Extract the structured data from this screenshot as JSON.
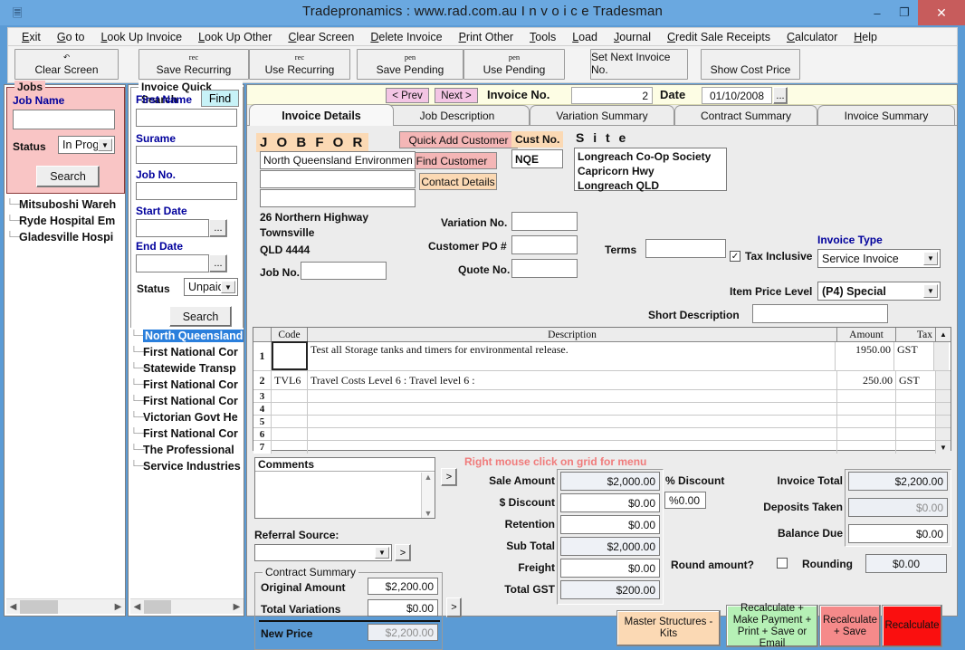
{
  "window": {
    "title": "Tradepronamics :   www.rad.com.au     I n v o i c e   Tradesman",
    "minimize": "–",
    "maximize": "❐",
    "close": "✕"
  },
  "menu": [
    "Exit",
    "Go to",
    "Look Up Invoice",
    "Look Up Other",
    "Clear Screen",
    "Delete Invoice",
    "Print Other",
    "Tools",
    "Load",
    "Journal",
    "Credit Sale Receipts",
    "Calculator",
    "Help"
  ],
  "toolbar": [
    {
      "glyph": "↶",
      "label": "Clear Screen"
    },
    {
      "glyph": "rec",
      "label": "Save Recurring"
    },
    {
      "glyph": "rec",
      "label": "Use Recurring"
    },
    {
      "glyph": "pen",
      "label": "Save Pending"
    },
    {
      "glyph": "pen",
      "label": "Use Pending"
    },
    {
      "glyph": "",
      "label": "Set Next  Invoice No."
    },
    {
      "glyph": "",
      "label": "Show Cost Price"
    }
  ],
  "jobs_panel": {
    "legend": "Jobs",
    "job_name_label": "Job Name",
    "job_name_value": "",
    "status_label": "Status",
    "status_value": "In Progr",
    "search_label": "Search",
    "tree": [
      "Mitsuboshi Wareh",
      "Ryde Hospital Em",
      "Gladesville Hospi"
    ]
  },
  "quick_search": {
    "legend": "Invoice Quick Search",
    "find_label": "Find",
    "first_name_label": "First Name",
    "first_name_value": "",
    "surname_label": "Surame",
    "surname_value": "",
    "job_no_label": "Job No.",
    "job_no_value": "",
    "start_date_label": "Start Date",
    "start_date_value": "",
    "end_date_label": "End Date",
    "end_date_value": "",
    "status_label": "Status",
    "status_value": "Unpaid",
    "search_label": "Search",
    "dots": "...",
    "results": [
      "North Queensland",
      "First National Cor",
      "Statewide Transp",
      "First National Cor",
      "First National Cor",
      "Victorian Govt He",
      "First National Cor",
      "The Professional",
      "Service Industries"
    ]
  },
  "invoice_bar": {
    "prev": "< Prev",
    "next": "Next >",
    "invoice_no_label": "Invoice No.",
    "invoice_no_value": "2",
    "date_label": "Date",
    "date_value": "01/10/2008",
    "date_picker": "..."
  },
  "tabs": [
    {
      "label": "Invoice Details",
      "active": true
    },
    {
      "label": "Job Description",
      "active": false
    },
    {
      "label": "Variation Summary",
      "active": false
    },
    {
      "label": "Contract Summary",
      "active": false
    },
    {
      "label": "Invoice Summary",
      "active": false
    }
  ],
  "details": {
    "job_for_label": "J O B  F O R",
    "quick_add_customer": "Quick Add Customer",
    "find_customer": "Find Customer",
    "contact_details": "Contact Details",
    "customer_name": "North Queensland Environmen",
    "customer_line2": "",
    "customer_line3": "",
    "address_line1": "26 Northern Highway",
    "address_line2": "Townsville",
    "address_line3": "QLD  4444",
    "job_no_label": "Job No.",
    "job_no_value": "",
    "cust_no_label": "Cust No.",
    "cust_no_value": "NQE",
    "site_label": "S i t e",
    "site_lines": [
      "Longreach Co-Op Society",
      "Capricorn Hwy",
      "Longreach QLD"
    ],
    "variation_no_label": "Variation No.",
    "variation_no_value": "",
    "customer_po_label": "Customer PO #",
    "customer_po_value": "",
    "quote_no_label": "Quote No.",
    "quote_no_value": "",
    "tax_inclusive_label": "Tax Inclusive",
    "tax_inclusive_checked": true,
    "invoice_type_label": "Invoice Type",
    "invoice_type_value": "Service Invoice",
    "terms_label": "Terms",
    "terms_value": "",
    "item_price_level_label": "Item Price Level",
    "item_price_level_value": "(P4) Special",
    "short_description_label": "Short Description",
    "short_description_value": ""
  },
  "grid": {
    "columns": [
      "",
      "Code",
      "Description",
      "Amount",
      "Tax"
    ],
    "rows": [
      {
        "n": "1",
        "code": "",
        "description": "Test all Storage tanks and timers for environmental release.",
        "amount": "1950.00",
        "tax": "GST"
      },
      {
        "n": "2",
        "code": "TVL6",
        "description": "Travel Costs Level 6 : Travel level 6 :",
        "amount": "250.00",
        "tax": "GST"
      },
      {
        "n": "3",
        "code": "",
        "description": "",
        "amount": "",
        "tax": ""
      },
      {
        "n": "4",
        "code": "",
        "description": "",
        "amount": "",
        "tax": ""
      },
      {
        "n": "5",
        "code": "",
        "description": "",
        "amount": "",
        "tax": ""
      },
      {
        "n": "6",
        "code": "",
        "description": "",
        "amount": "",
        "tax": ""
      },
      {
        "n": "7",
        "code": "",
        "description": "",
        "amount": "",
        "tax": ""
      }
    ]
  },
  "hint": "Right mouse click on grid for menu",
  "comments": {
    "label": "Comments",
    "value": "",
    "expand": ">"
  },
  "referral": {
    "label": "Referral Source:",
    "value": "",
    "expand": ">"
  },
  "contract_summary": {
    "legend": "Contract Summary",
    "original_amount_label": "Original Amount",
    "original_amount_value": "$2,200.00",
    "total_variations_label": "Total Variations",
    "total_variations_value": "$0.00",
    "new_price_label": "New Price",
    "new_price_value": "$2,200.00",
    "expand": ">"
  },
  "totals_left": [
    {
      "label": "Sale Amount",
      "value": "$2,000.00",
      "readonly": true
    },
    {
      "label": "$ Discount",
      "value": "$0.00",
      "readonly": false
    },
    {
      "label": "Retention",
      "value": "$0.00",
      "readonly": false
    },
    {
      "label": "Sub Total",
      "value": "$2,000.00",
      "readonly": true
    },
    {
      "label": "Freight",
      "value": "$0.00",
      "readonly": false
    },
    {
      "label": "Total GST",
      "value": "$200.00",
      "readonly": true
    }
  ],
  "discount": {
    "label": "% Discount",
    "value": "%0.00"
  },
  "totals_right": [
    {
      "label": "Invoice Total",
      "value": "$2,200.00",
      "style": "ro"
    },
    {
      "label": "Deposits Taken",
      "value": "$0.00",
      "style": "gray"
    },
    {
      "label": "Balance Due",
      "value": "$0.00",
      "style": ""
    }
  ],
  "rounding": {
    "round_label": "Round amount?",
    "checked": false,
    "rounding_label": "Rounding",
    "rounding_value": "$0.00"
  },
  "actions": [
    {
      "label": "Master Structures - Kits",
      "color": "#fbd9b4"
    },
    {
      "label": "Recalculate + Make Payment + Print + Save or Email",
      "color": "#b6f0b6"
    },
    {
      "label": "Recalculate + Save",
      "color": "#f58a8a"
    },
    {
      "label": "Recalculate",
      "color": "#fa0f0f"
    }
  ],
  "colors": {
    "title_bar": "#6aa8e0",
    "jobs_panel": "#f9c5c5",
    "invoice_bar": "#fdfde4",
    "accent_blue": "#00009c",
    "hint_red": "#f07b7b"
  }
}
